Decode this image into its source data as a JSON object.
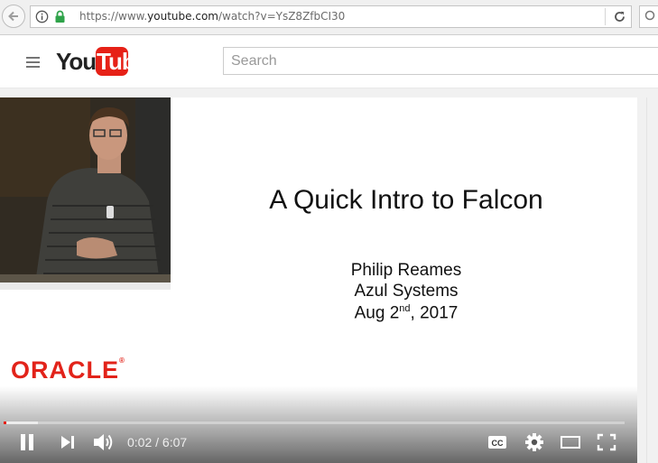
{
  "browser": {
    "url_prefix": "https://www.",
    "url_domain": "youtube.com",
    "url_path": "/watch?v=YsZ8ZfbCI30"
  },
  "masthead": {
    "logo_you": "You",
    "logo_tube": "Tube",
    "search_placeholder": "Search"
  },
  "slide": {
    "title": "A Quick Intro to Falcon",
    "author": "Philip Reames",
    "company": "Azul Systems",
    "date_prefix": "Aug 2",
    "date_sup": "nd",
    "date_suffix": ", 2017",
    "brand": "ORACLE"
  },
  "player": {
    "current_time": "0:02",
    "separator": " / ",
    "duration": "6:07",
    "progress_played_fraction": 0.005,
    "progress_loaded_fraction": 0.055,
    "accent_color": "#e62117"
  },
  "icons": {
    "back": "back-arrow-icon",
    "info": "info-icon",
    "lock": "lock-icon",
    "reload": "reload-icon",
    "menu": "hamburger-menu-icon",
    "pause": "pause-icon",
    "next": "next-icon",
    "volume": "volume-icon",
    "captions": "cc-icon",
    "settings": "gear-icon",
    "theater": "theater-mode-icon",
    "fullscreen": "fullscreen-icon"
  }
}
